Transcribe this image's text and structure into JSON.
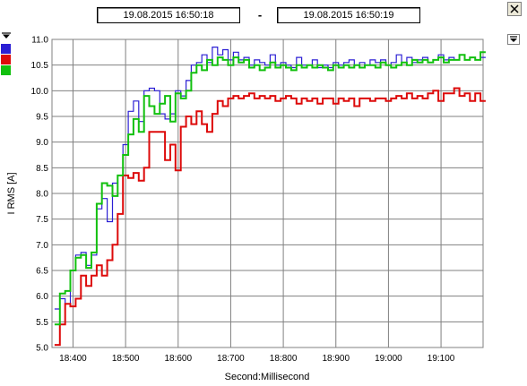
{
  "header": {
    "start_time": "19.08.2015    16:50:18",
    "separator": "-",
    "end_time": "19.08.2015    16:50:19"
  },
  "colors": {
    "series1": "#2b1fd4",
    "series2": "#dd0a0a",
    "series3": "#12c00f",
    "grid": "#808080",
    "background": "#ffffff"
  },
  "legend_swatches": [
    "blue-swatch",
    "red-swatch",
    "green-swatch"
  ],
  "chart_data": {
    "type": "line",
    "step": true,
    "xlabel": "Second:Millisecond",
    "ylabel": "I RMS [A]",
    "xlim": [
      18360,
      19180
    ],
    "ylim": [
      5.0,
      11.0
    ],
    "x_ticks": [
      "18:400",
      "18:500",
      "18:600",
      "18:700",
      "18:800",
      "18:900",
      "19:000",
      "19:100"
    ],
    "y_ticks": [
      "5.0",
      "5.5",
      "6.0",
      "6.5",
      "7.0",
      "7.5",
      "8.0",
      "8.5",
      "9.0",
      "9.5",
      "10.0",
      "10.5",
      "11.0"
    ],
    "grid": true,
    "series": [
      {
        "color": "#2b1fd4",
        "x": [
          18365,
          18375,
          18385,
          18395,
          18405,
          18415,
          18425,
          18435,
          18445,
          18455,
          18465,
          18475,
          18485,
          18495,
          18505,
          18515,
          18525,
          18535,
          18545,
          18555,
          18565,
          18575,
          18585,
          18595,
          18605,
          18615,
          18625,
          18635,
          18645,
          18655,
          18665,
          18675,
          18685,
          18695,
          18705,
          18715,
          18725,
          18735,
          18745,
          18755,
          18765,
          18775,
          18785,
          18795,
          18805,
          18815,
          18825,
          18835,
          18845,
          18855,
          18865,
          18875,
          18885,
          18895,
          18905,
          18915,
          18925,
          18935,
          18945,
          18955,
          18965,
          18975,
          18985,
          18995,
          19005,
          19015,
          19025,
          19035,
          19045,
          19055,
          19065,
          19075,
          19085,
          19095,
          19105,
          19115,
          19125,
          19135,
          19145,
          19155,
          19165,
          19175
        ],
        "y": [
          5.75,
          5.95,
          5.85,
          6.5,
          6.8,
          6.85,
          6.6,
          6.8,
          7.7,
          7.9,
          7.45,
          8.2,
          8.35,
          8.95,
          9.6,
          9.8,
          9.4,
          10.0,
          10.05,
          10.0,
          9.55,
          9.45,
          9.55,
          10.0,
          9.9,
          10.2,
          10.5,
          10.55,
          10.7,
          10.55,
          10.85,
          10.7,
          10.8,
          10.6,
          10.75,
          10.6,
          10.65,
          10.5,
          10.6,
          10.55,
          10.5,
          10.7,
          10.5,
          10.55,
          10.5,
          10.45,
          10.65,
          10.5,
          10.5,
          10.6,
          10.45,
          10.5,
          10.45,
          10.55,
          10.5,
          10.55,
          10.6,
          10.5,
          10.55,
          10.5,
          10.6,
          10.55,
          10.6,
          10.5,
          10.55,
          10.7,
          10.55,
          10.65,
          10.55,
          10.6,
          10.65,
          10.55,
          10.6,
          10.7,
          10.6,
          10.65,
          10.6,
          10.7,
          10.6,
          10.65,
          10.6,
          10.65
        ]
      },
      {
        "color": "#dd0a0a",
        "x": [
          18365,
          18375,
          18385,
          18395,
          18405,
          18415,
          18425,
          18435,
          18445,
          18455,
          18465,
          18475,
          18485,
          18495,
          18505,
          18515,
          18525,
          18535,
          18545,
          18555,
          18565,
          18575,
          18585,
          18595,
          18605,
          18615,
          18625,
          18635,
          18645,
          18655,
          18665,
          18675,
          18685,
          18695,
          18705,
          18715,
          18725,
          18735,
          18745,
          18755,
          18765,
          18775,
          18785,
          18795,
          18805,
          18815,
          18825,
          18835,
          18845,
          18855,
          18865,
          18875,
          18885,
          18895,
          18905,
          18915,
          18925,
          18935,
          18945,
          18955,
          18965,
          18975,
          18985,
          18995,
          19005,
          19015,
          19025,
          19035,
          19045,
          19055,
          19065,
          19075,
          19085,
          19095,
          19105,
          19115,
          19125,
          19135,
          19145,
          19155,
          19165,
          19175
        ],
        "y": [
          5.05,
          5.45,
          5.85,
          5.8,
          5.95,
          6.4,
          6.2,
          6.4,
          6.6,
          6.4,
          6.7,
          7.0,
          7.6,
          8.35,
          8.3,
          8.4,
          8.25,
          8.5,
          9.2,
          9.2,
          9.2,
          8.65,
          8.95,
          8.45,
          9.3,
          9.5,
          9.35,
          9.6,
          9.35,
          9.2,
          9.55,
          9.8,
          9.7,
          9.85,
          9.9,
          9.85,
          9.9,
          9.95,
          9.85,
          9.9,
          9.85,
          9.9,
          9.8,
          9.85,
          9.9,
          9.85,
          9.75,
          9.85,
          9.8,
          9.85,
          9.75,
          9.85,
          9.85,
          9.75,
          9.85,
          9.8,
          9.85,
          9.7,
          9.85,
          9.85,
          9.8,
          9.85,
          9.85,
          9.8,
          9.85,
          9.9,
          9.85,
          9.95,
          9.85,
          9.9,
          9.85,
          9.95,
          10.0,
          9.8,
          9.95,
          9.95,
          10.05,
          9.9,
          9.95,
          9.8,
          9.95,
          9.8
        ]
      },
      {
        "color": "#12c00f",
        "x": [
          18365,
          18375,
          18385,
          18395,
          18405,
          18415,
          18425,
          18435,
          18445,
          18455,
          18465,
          18475,
          18485,
          18495,
          18505,
          18515,
          18525,
          18535,
          18545,
          18555,
          18565,
          18575,
          18585,
          18595,
          18605,
          18615,
          18625,
          18635,
          18645,
          18655,
          18665,
          18675,
          18685,
          18695,
          18705,
          18715,
          18725,
          18735,
          18745,
          18755,
          18765,
          18775,
          18785,
          18795,
          18805,
          18815,
          18825,
          18835,
          18845,
          18855,
          18865,
          18875,
          18885,
          18895,
          18905,
          18915,
          18925,
          18935,
          18945,
          18955,
          18965,
          18975,
          18985,
          18995,
          19005,
          19015,
          19025,
          19035,
          19045,
          19055,
          19065,
          19075,
          19085,
          19095,
          19105,
          19115,
          19125,
          19135,
          19145,
          19155,
          19165,
          19175
        ],
        "y": [
          5.45,
          6.05,
          6.1,
          6.5,
          6.75,
          6.8,
          6.55,
          6.85,
          7.8,
          8.2,
          8.15,
          7.95,
          8.35,
          8.75,
          9.15,
          9.45,
          9.2,
          9.9,
          9.7,
          9.55,
          9.75,
          9.9,
          9.4,
          9.95,
          9.85,
          10.0,
          10.35,
          10.5,
          10.4,
          10.6,
          10.5,
          10.65,
          10.6,
          10.5,
          10.65,
          10.55,
          10.6,
          10.45,
          10.5,
          10.4,
          10.45,
          10.55,
          10.45,
          10.5,
          10.45,
          10.4,
          10.5,
          10.45,
          10.5,
          10.45,
          10.5,
          10.45,
          10.4,
          10.5,
          10.45,
          10.5,
          10.45,
          10.5,
          10.45,
          10.5,
          10.5,
          10.45,
          10.55,
          10.5,
          10.45,
          10.5,
          10.55,
          10.5,
          10.6,
          10.55,
          10.6,
          10.55,
          10.6,
          10.65,
          10.55,
          10.6,
          10.6,
          10.7,
          10.6,
          10.65,
          10.6,
          10.75
        ]
      }
    ]
  }
}
